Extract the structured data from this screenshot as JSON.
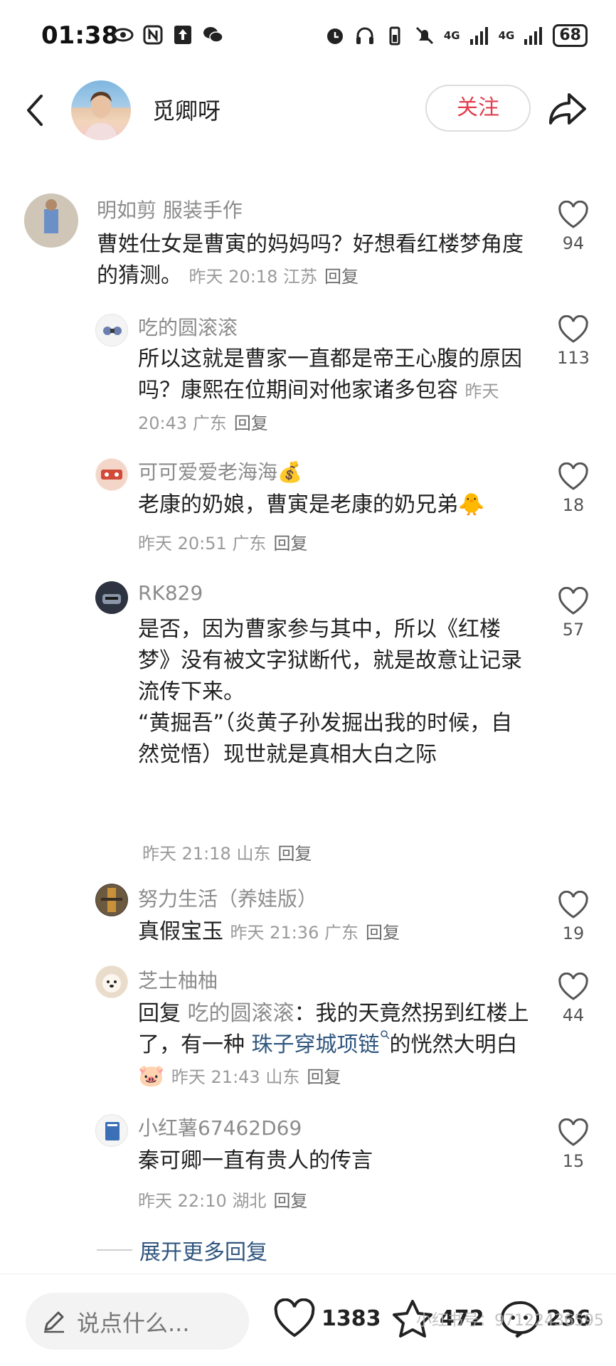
{
  "status_bar": {
    "time": "01:38",
    "battery": "68",
    "net1": "4G",
    "net2": "4G"
  },
  "header": {
    "user_name": "觅卿呀",
    "follow_label": "关注"
  },
  "comments": [
    {
      "author": "明如剪 服装手作",
      "text": "曹姓仕女是曹寅的妈妈吗？好想看红楼梦角度的猜测。",
      "time": "昨天 20:18",
      "loc": "江苏",
      "reply": "回复",
      "likes": "94"
    },
    {
      "author": "吃的圆滚滚",
      "text": "所以这就是曹家一直都是帝王心腹的原因吗？康熙在位期间对他家诸多包容",
      "time": "昨天 20:43",
      "loc": "广东",
      "reply": "回复",
      "likes": "113"
    },
    {
      "author": "可可爱爱老海海💰",
      "text": "老康的奶娘，曹寅是老康的奶兄弟🐥",
      "time": "昨天 20:51",
      "loc": "广东",
      "reply": "回复",
      "likes": "18"
    },
    {
      "author": "RK829",
      "text": "是否，因为曹家参与其中，所以《红楼梦》没有被文字狱断代，就是故意让记录流传下来。",
      "text2": "“黄掘吾”（炎黄子孙发掘出我的时候，自然觉悟）现世就是真相大白之际",
      "time": "昨天 21:18",
      "loc": "山东",
      "reply": "回复",
      "likes": "57"
    },
    {
      "author": "努力生活（养娃版）",
      "text": "真假宝玉",
      "time": "昨天 21:36",
      "loc": "广东",
      "reply": "回复",
      "likes": "19"
    },
    {
      "author": "芝士柚柚",
      "reply_prefix": "回复",
      "reply_to": "吃的圆滚滚",
      "text_a": "：我的天竟然拐到红楼上了，有一种",
      "tag": "珠子穿城项链",
      "text_b": "的恍然大明白🐷",
      "time": "昨天 21:43",
      "loc": "山东",
      "reply": "回复",
      "likes": "44"
    },
    {
      "author": "小红薯67462D69",
      "text": "秦可卿一直有贵人的传言",
      "time": "昨天 22:10",
      "loc": "湖北",
      "reply": "回复",
      "likes": "15"
    }
  ],
  "expand_label": "展开更多回复",
  "bottom_bar": {
    "input_placeholder": "说点什么...",
    "likes": "1383",
    "stars": "472",
    "comments": "236"
  },
  "watermark": "小红书号：97122436595"
}
